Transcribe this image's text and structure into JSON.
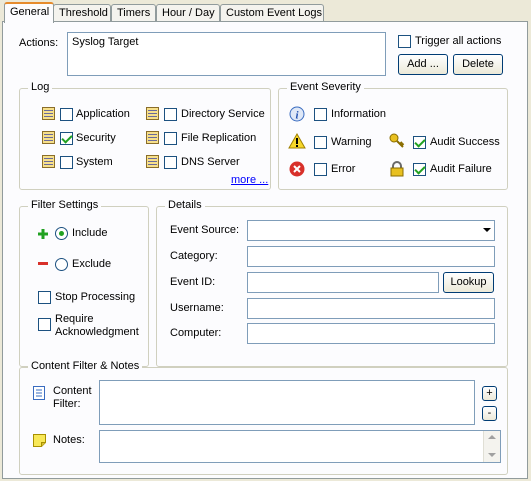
{
  "tabs": [
    "General",
    "Threshold",
    "Timers",
    "Hour / Day",
    "Custom Event Logs"
  ],
  "actions": {
    "label": "Actions:",
    "items": [
      "Syslog Target"
    ],
    "trigger_all_label": "Trigger all actions",
    "trigger_all_checked": false,
    "add_label": "Add ...",
    "delete_label": "Delete"
  },
  "log": {
    "title": "Log",
    "items": [
      {
        "label": "Application",
        "checked": false
      },
      {
        "label": "Security",
        "checked": true
      },
      {
        "label": "System",
        "checked": false
      },
      {
        "label": "Directory Service",
        "checked": false
      },
      {
        "label": "File Replication",
        "checked": false
      },
      {
        "label": "DNS Server",
        "checked": false
      }
    ],
    "more_label": "more ..."
  },
  "severity": {
    "title": "Event Severity",
    "information_label": "Information",
    "warning_label": "Warning",
    "error_label": "Error",
    "audit_success_label": "Audit Success",
    "audit_failure_label": "Audit Failure",
    "information_checked": false,
    "warning_checked": false,
    "error_checked": false,
    "audit_success_checked": true,
    "audit_failure_checked": true
  },
  "filter": {
    "title": "Filter Settings",
    "include_label": "Include",
    "exclude_label": "Exclude",
    "include_selected": true,
    "stop_processing_label": "Stop Processing",
    "require_ack_label_1": "Require",
    "require_ack_label_2": "Acknowledgment"
  },
  "details": {
    "title": "Details",
    "event_source_label": "Event Source:",
    "event_source_value": "",
    "category_label": "Category:",
    "category_value": "",
    "event_id_label": "Event ID:",
    "event_id_value": "",
    "lookup_label": "Lookup",
    "username_label": "Username:",
    "username_value": "",
    "computer_label": "Computer:",
    "computer_value": ""
  },
  "content": {
    "title": "Content Filter & Notes",
    "content_filter_label_1": "Content",
    "content_filter_label_2": "Filter:",
    "content_filter_value": "",
    "notes_label": "Notes:",
    "notes_value": "",
    "plus_label": "+",
    "minus_label": "-"
  }
}
